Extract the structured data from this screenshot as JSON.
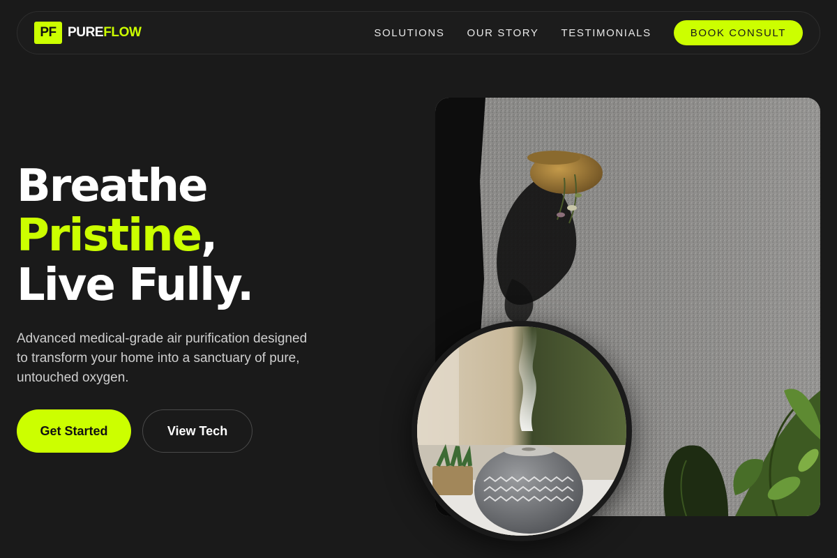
{
  "nav": {
    "brand_mark": "PF",
    "brand_pure": "PURE",
    "brand_flow": "FLOW",
    "links": [
      "SOLUTIONS",
      "OUR STORY",
      "TESTIMONIALS"
    ],
    "cta": "BOOK CONSULT"
  },
  "hero": {
    "headline_line1": "Breathe",
    "headline_accent": "Pristine",
    "headline_comma": ",",
    "headline_line3": "Live Fully.",
    "lead": "Advanced medical-grade air purification designed to transform your home into a sanctuary of pure, untouched oxygen.",
    "primary_button": "Get Started",
    "secondary_button": "View Tech"
  },
  "colors": {
    "background": "#1a1a1a",
    "accent": "#ccff00",
    "text": "#ffffff",
    "muted_text": "#cfcfcf"
  },
  "images": {
    "wall_photo": "textured-wall-with-hanging-plant-pot",
    "diffuser_photo": "ceramic-aroma-diffuser-with-mist"
  }
}
